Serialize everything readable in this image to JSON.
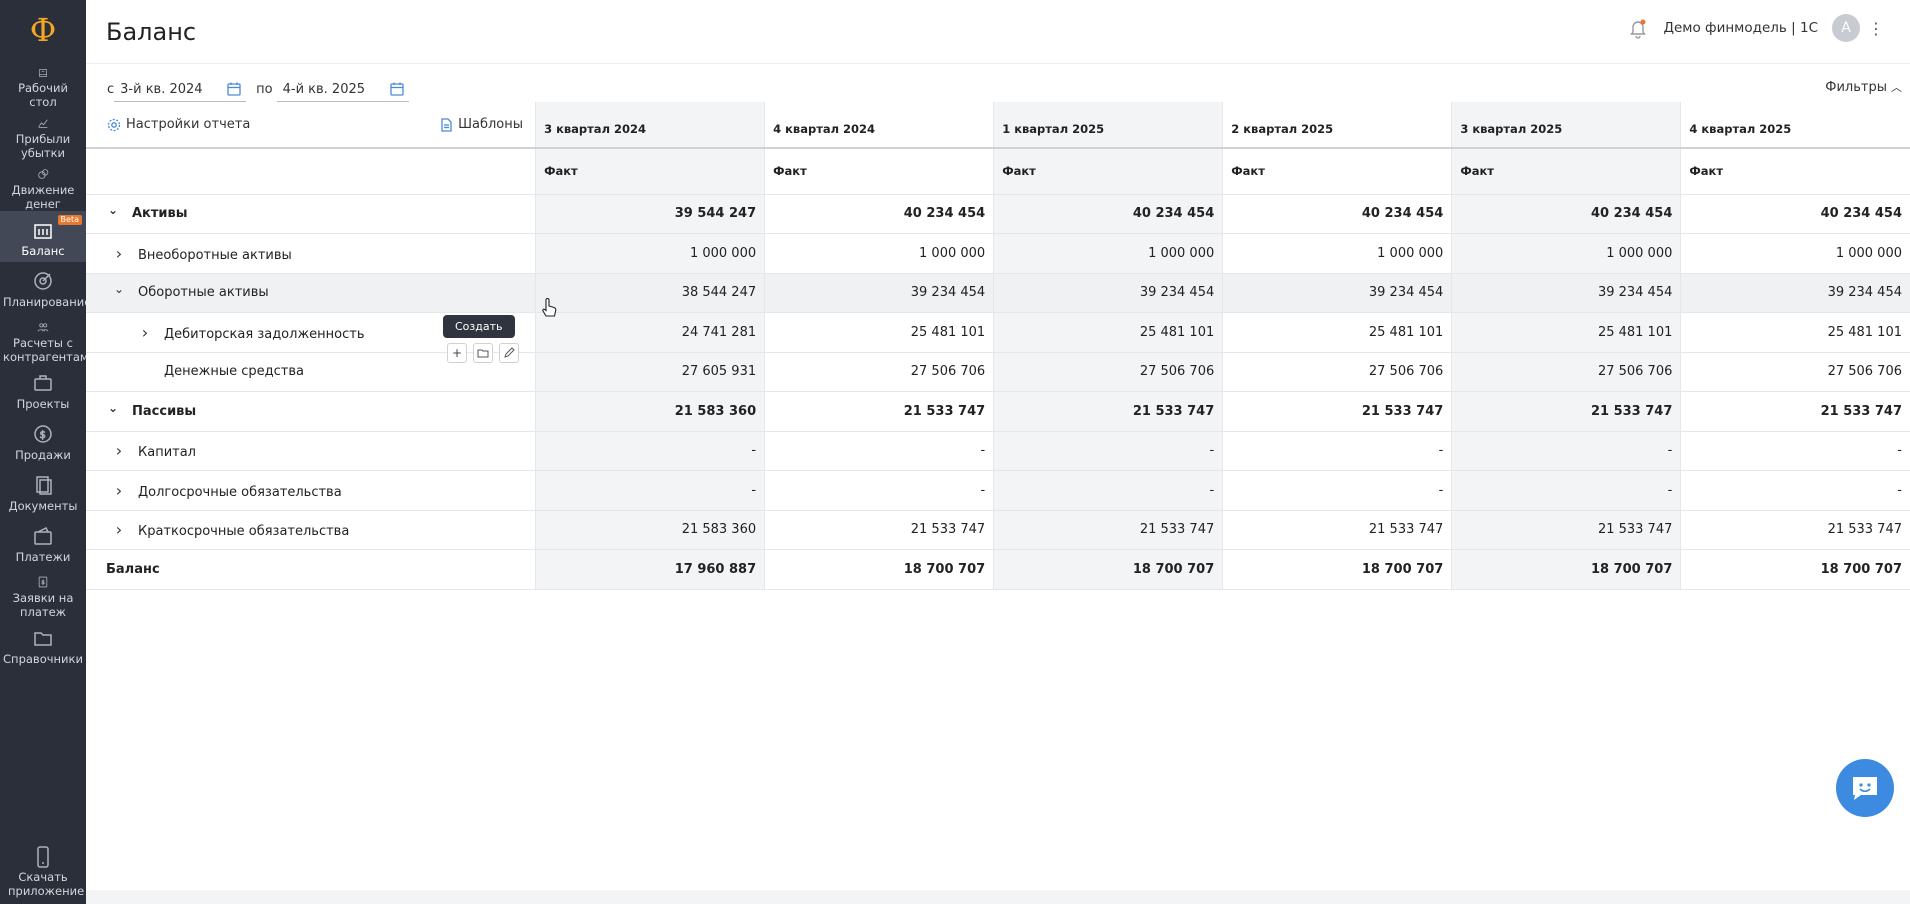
{
  "logo": "Ф",
  "sidebar": {
    "items": [
      {
        "label": "Рабочий стол",
        "icon": "desktop-icon"
      },
      {
        "label": "Прибыли убытки",
        "icon": "chart-icon"
      },
      {
        "label": "Движение денег",
        "icon": "money-icon"
      },
      {
        "label": "Баланс",
        "icon": "balance-icon",
        "badge": "Beta",
        "active": true
      },
      {
        "label": "Планирование",
        "icon": "planning-icon"
      },
      {
        "label": "Расчеты с контрагентами",
        "icon": "contractors-icon"
      },
      {
        "label": "Проекты",
        "icon": "projects-icon"
      },
      {
        "label": "Продажи",
        "icon": "sales-icon"
      },
      {
        "label": "Документы",
        "icon": "documents-icon"
      },
      {
        "label": "Платежи",
        "icon": "wallet-icon"
      },
      {
        "label": "Заявки на платеж",
        "icon": "request-icon"
      },
      {
        "label": "Справочники",
        "icon": "folder-icon"
      }
    ],
    "download": "Скачать приложение"
  },
  "header": {
    "title": "Баланс",
    "org": "Демо финмодель | 1С",
    "avatar": "А"
  },
  "period": {
    "from_label": "с",
    "from_value": "3-й кв. 2024",
    "to_label": "по",
    "to_value": "4-й кв. 2025"
  },
  "filters_label": "Фильтры",
  "report_settings": "Настройки отчета",
  "templates": "Шаблоны",
  "tooltip": "Создать",
  "columns": [
    "3 квартал 2024",
    "4 квартал 2024",
    "1 квартал 2025",
    "2 квартал 2025",
    "3 квартал 2025",
    "4 квартал 2025"
  ],
  "subheader": "Факт",
  "rows": [
    {
      "label": "Активы",
      "level": 0,
      "chev": "down",
      "bold": true,
      "values": [
        "39 544 247",
        "40 234 454",
        "40 234 454",
        "40 234 454",
        "40 234 454",
        "40 234 454"
      ]
    },
    {
      "label": "Внеоборотные активы",
      "level": 1,
      "chev": "right",
      "bold": false,
      "values": [
        "1 000 000",
        "1 000 000",
        "1 000 000",
        "1 000 000",
        "1 000 000",
        "1 000 000"
      ]
    },
    {
      "label": "Оборотные активы",
      "level": 1,
      "chev": "down",
      "bold": false,
      "values": [
        "38 544 247",
        "39 234 454",
        "39 234 454",
        "39 234 454",
        "39 234 454",
        "39 234 454"
      ]
    },
    {
      "label": "Дебиторская задолженность",
      "level": 2,
      "chev": "right",
      "bold": false,
      "values": [
        "24 741 281",
        "25 481 101",
        "25 481 101",
        "25 481 101",
        "25 481 101",
        "25 481 101"
      ]
    },
    {
      "label": "Денежные средства",
      "level": 3,
      "chev": "",
      "bold": false,
      "values": [
        "27 605 931",
        "27 506 706",
        "27 506 706",
        "27 506 706",
        "27 506 706",
        "27 506 706"
      ]
    },
    {
      "label": "Пассивы",
      "level": 0,
      "chev": "down",
      "bold": true,
      "values": [
        "21 583 360",
        "21 533 747",
        "21 533 747",
        "21 533 747",
        "21 533 747",
        "21 533 747"
      ]
    },
    {
      "label": "Капитал",
      "level": 1,
      "chev": "right",
      "bold": false,
      "values": [
        "-",
        "-",
        "-",
        "-",
        "-",
        "-"
      ]
    },
    {
      "label": "Долгосрочные обязательства",
      "level": 1,
      "chev": "right",
      "bold": false,
      "values": [
        "-",
        "-",
        "-",
        "-",
        "-",
        "-"
      ]
    },
    {
      "label": "Краткосрочные обязательства",
      "level": 1,
      "chev": "right",
      "bold": false,
      "values": [
        "21 583 360",
        "21 533 747",
        "21 533 747",
        "21 533 747",
        "21 533 747",
        "21 533 747"
      ]
    },
    {
      "label": "Баланс",
      "level": 0,
      "chev": "",
      "bold": true,
      "values": [
        "17 960 887",
        "18 700 707",
        "18 700 707",
        "18 700 707",
        "18 700 707",
        "18 700 707"
      ]
    }
  ]
}
